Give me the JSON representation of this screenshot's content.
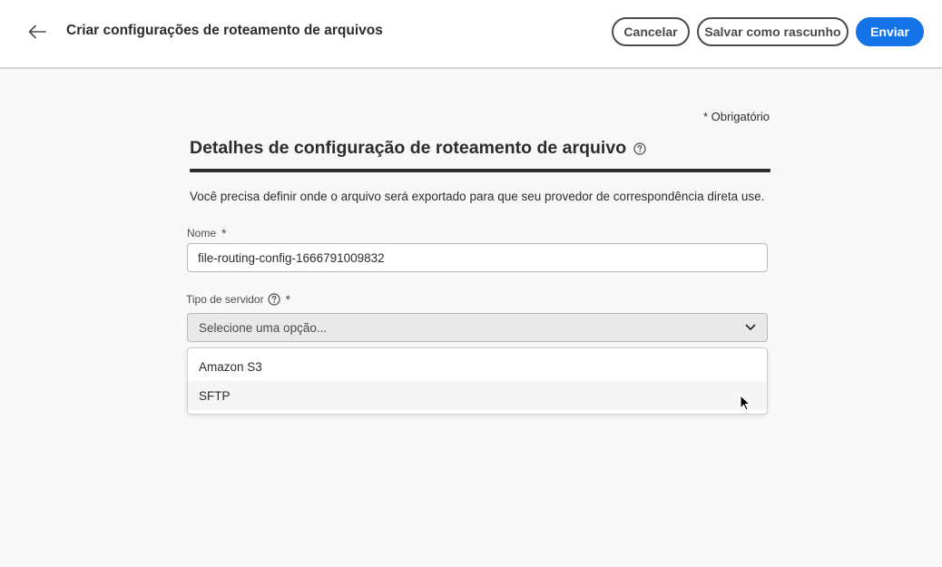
{
  "header": {
    "title": "Criar configurações de roteamento de arquivos",
    "back_icon": "arrow-left-icon",
    "cancel_label": "Cancelar",
    "draft_label": "Salvar como rascunho",
    "submit_label": "Enviar"
  },
  "form": {
    "required_note": "* Obrigatório",
    "section_title": "Detalhes de configuração de roteamento de arquivo",
    "description": "Você precisa definir onde o arquivo será exportado para que seu provedor de correspondência direta use.",
    "name": {
      "label": "Nome",
      "required_marker": "*",
      "value": "file-routing-config-1666791009832"
    },
    "server_type": {
      "label": "Tipo de servidor",
      "required_marker": "*",
      "placeholder": "Selecione uma opção...",
      "options": [
        "Amazon S3",
        "SFTP"
      ],
      "hovered_option": "SFTP"
    }
  },
  "colors": {
    "accent": "#1473e6",
    "text": "#2c2c2c",
    "background": "#f8f8f8"
  }
}
